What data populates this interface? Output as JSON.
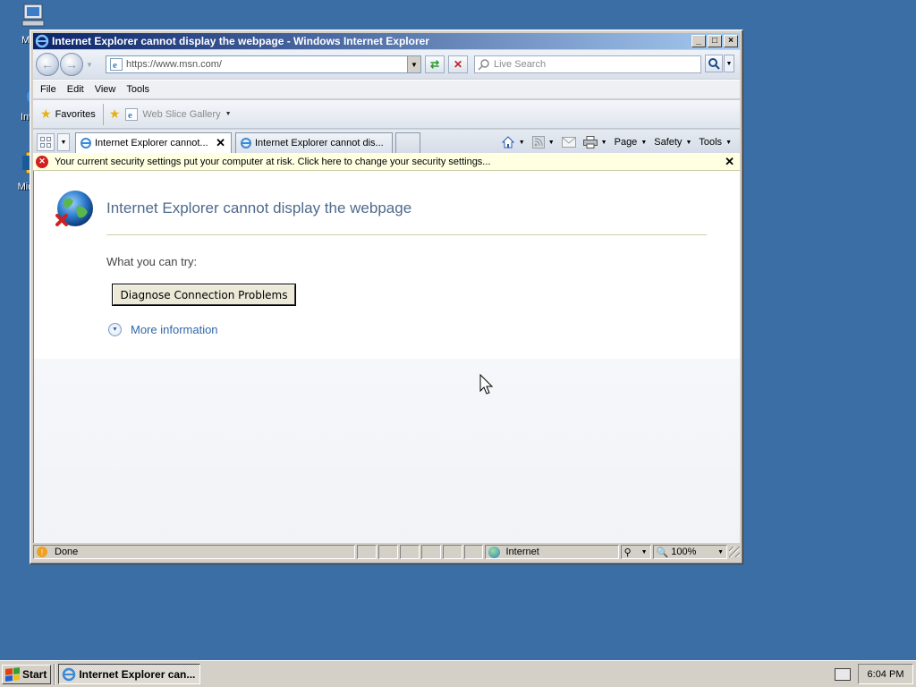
{
  "desktop": {
    "icons": [
      {
        "label": "My C",
        "icon": "my-computer-icon"
      },
      {
        "label": "Int Ex",
        "icon": "internet-explorer-icon"
      },
      {
        "label": "Mic Ou",
        "icon": "outlook-icon"
      }
    ]
  },
  "window": {
    "title": "Internet Explorer cannot display the webpage - Windows Internet Explorer",
    "controls": {
      "minimize": "_",
      "maximize": "□",
      "close": "×"
    }
  },
  "navbar": {
    "address": "https://www.msn.com/",
    "search_placeholder": "Live Search"
  },
  "menubar": {
    "items": [
      "File",
      "Edit",
      "View",
      "Tools"
    ]
  },
  "favorites_bar": {
    "favorites_label": "Favorites",
    "web_slice_label": "Web Slice Gallery"
  },
  "tabs": [
    {
      "label": "Internet Explorer cannot...",
      "active": true
    },
    {
      "label": "Internet Explorer cannot dis...",
      "active": false
    }
  ],
  "command_bar": {
    "page_label": "Page",
    "safety_label": "Safety",
    "tools_label": "Tools"
  },
  "infobar": {
    "message": "Your current security settings put your computer at risk. Click here to change your security settings..."
  },
  "content": {
    "title": "Internet Explorer cannot display the webpage",
    "try_label": "What you can try:",
    "diagnose_button": "Diagnose Connection Problems",
    "more_info": "More information"
  },
  "statusbar": {
    "status": "Done",
    "zone": "Internet",
    "zoom": "100%"
  },
  "taskbar": {
    "start_label": "Start",
    "task_label": "Internet Explorer can...",
    "clock": "6:04 PM"
  },
  "colors": {
    "desktop": "#3a6ea5",
    "title_gradient_start": "#0a246a",
    "infobar_bg": "#ffffe1",
    "error_title": "#4e6a8c",
    "link": "#2e68aa"
  }
}
